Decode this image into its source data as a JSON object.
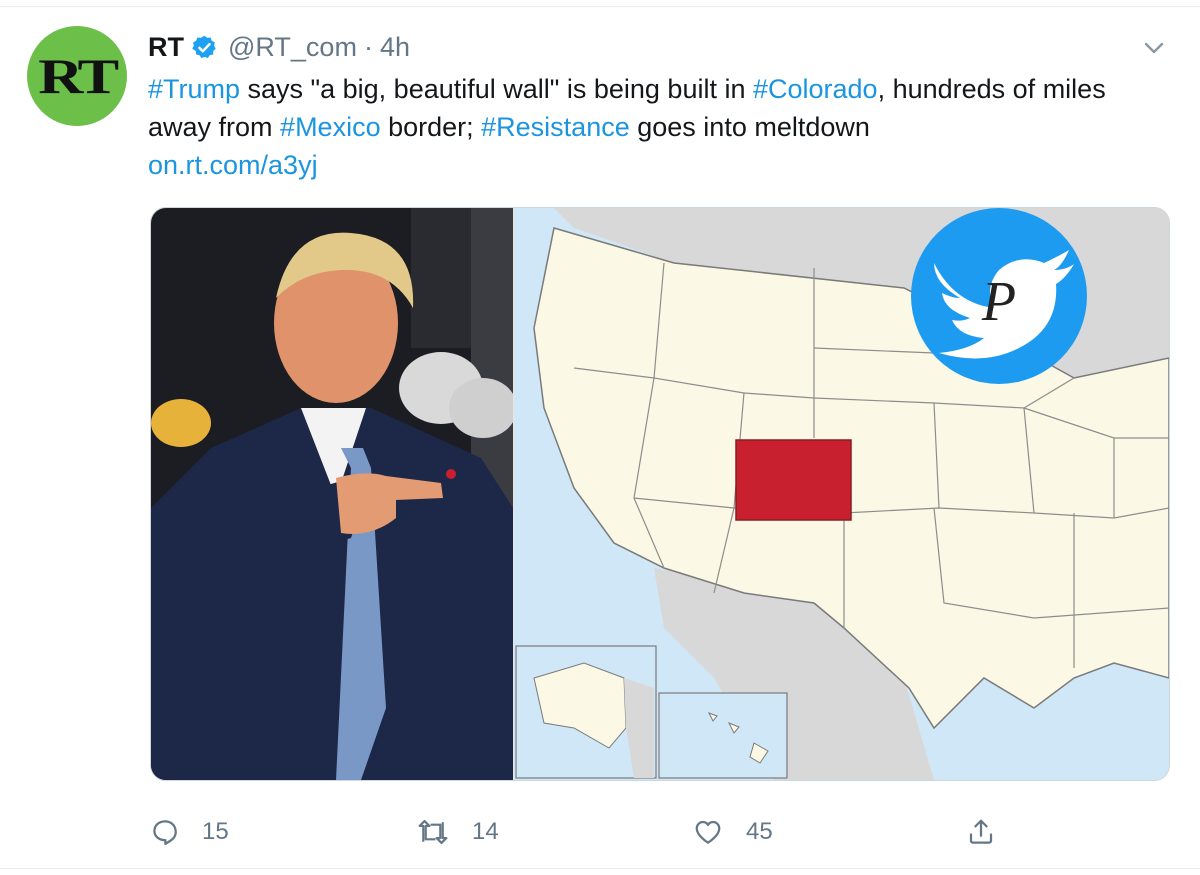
{
  "tweet": {
    "author_name": "RT",
    "handle": "@RT_com",
    "separator": "·",
    "time": "4h",
    "avatar_text": "RT",
    "text_parts": {
      "tag_trump": "#Trump",
      "t1": " says \"a big, beautiful wall\" is being built in ",
      "tag_colorado": "#Colorado",
      "t2": ", hundreds of miles away from ",
      "tag_mexico": "#Mexico",
      "t3": " border; ",
      "tag_resistance": "#Resistance",
      "t4": " goes into meltdown",
      "link": "on.rt.com/a3yj"
    }
  },
  "media": {
    "left_image": "photo-of-man-pointing",
    "right_image": "us-map-colorado-highlighted",
    "watermark": "twitter-bird-logo-with-letter-P",
    "watermark_letter": "P",
    "highlight_color": "#c8202e",
    "map_land_color": "#fbf8e6",
    "map_water_color": "#cfe7f7"
  },
  "actions": {
    "replies": "15",
    "retweets": "14",
    "likes": "45"
  },
  "colors": {
    "accent": "#1b95e0",
    "verified": "#1da1f2",
    "muted": "#657786"
  }
}
